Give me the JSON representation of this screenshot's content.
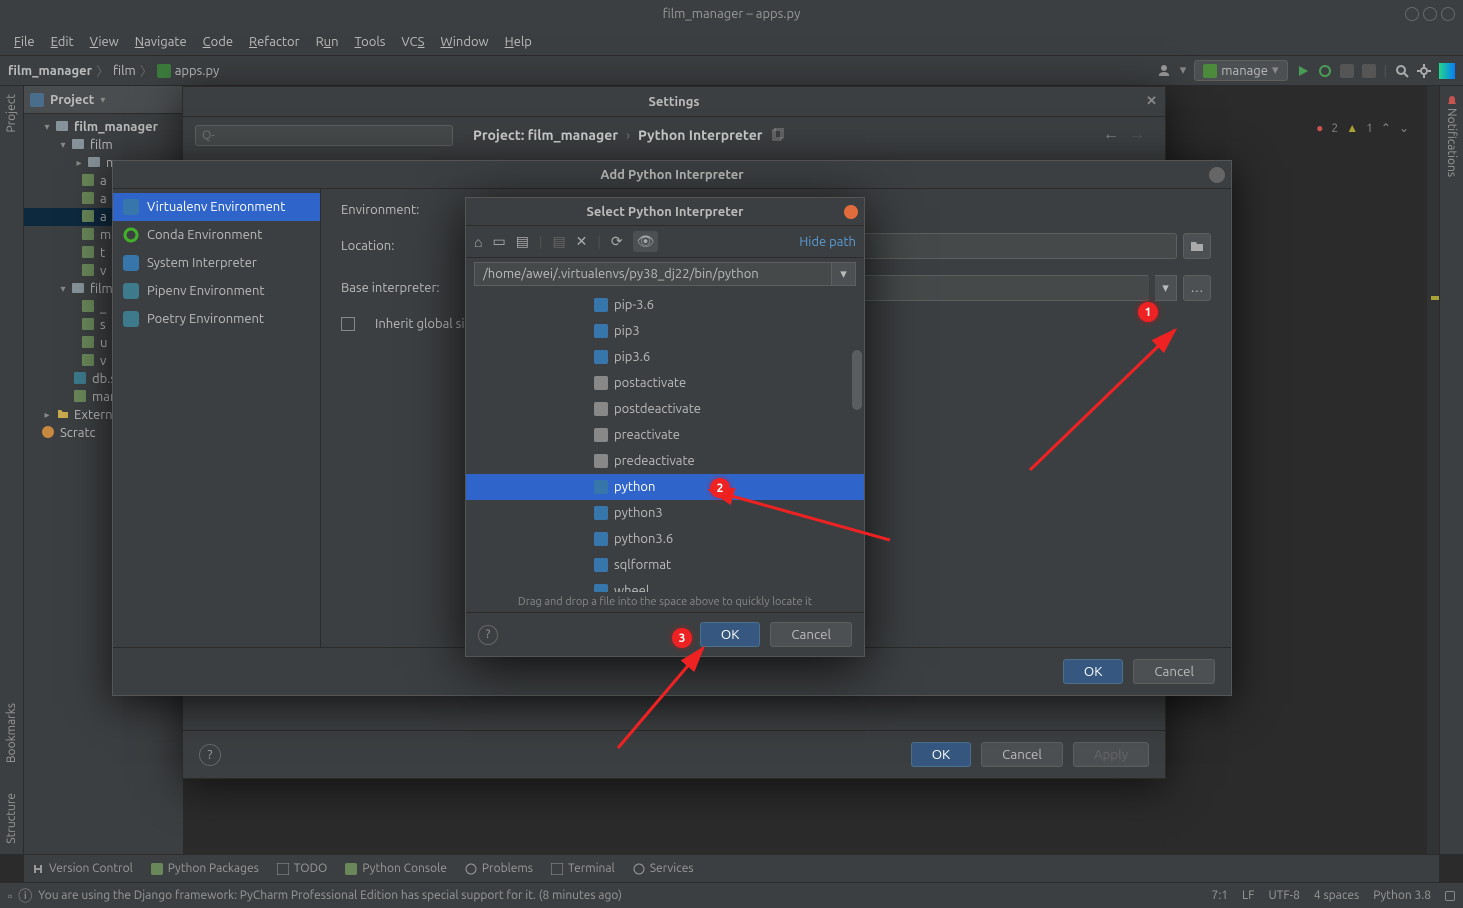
{
  "window": {
    "title": "film_manager – apps.py"
  },
  "menu": [
    "File",
    "Edit",
    "View",
    "Navigate",
    "Code",
    "Refactor",
    "Run",
    "Tools",
    "VCS",
    "Window",
    "Help"
  ],
  "breadcrumb": {
    "root": "film_manager",
    "mid": "film",
    "file": "apps.py"
  },
  "navbar": {
    "manage_btn": "manage"
  },
  "project_panel": {
    "header": "Project",
    "tree": {
      "root": "film_manager",
      "film_dir": "film",
      "m1": "m",
      "a_file": "a",
      "a2": "a",
      "m2": "m",
      "t": "t",
      "v": "v",
      "film2": "film",
      "underscore": "_",
      "s": "s",
      "u": "u",
      "v2": "v",
      "db": "db.s",
      "man": "mar",
      "extern": "Extern",
      "scratch": "Scratc"
    }
  },
  "gutters": {
    "project": "Project",
    "bookmarks": "Bookmarks",
    "structure": "Structure",
    "notifications": "Notifications"
  },
  "inspection": {
    "err": "2",
    "warn": "1"
  },
  "settings": {
    "title": "Settings",
    "search_ph": "Q-",
    "bc_project_label": "Project: film_manager",
    "bc_item": "Python Interpreter",
    "ok": "OK",
    "cancel": "Cancel",
    "apply": "Apply"
  },
  "add_interp": {
    "title": "Add Python Interpreter",
    "left": [
      "Virtualenv Environment",
      "Conda Environment",
      "System Interpreter",
      "Pipenv Environment",
      "Poetry Environment"
    ],
    "env_label": "Environment:",
    "loc_label": "Location:",
    "base_label": "Base interpreter:",
    "inherit": "Inherit global site",
    "ok": "OK",
    "cancel": "Cancel"
  },
  "select": {
    "title": "Select Python Interpreter",
    "hide_path": "Hide path",
    "path": "/home/awei/.virtualenvs/py38_dj22/bin/python",
    "items": [
      "pip-3.6",
      "pip3",
      "pip3.6",
      "postactivate",
      "postdeactivate",
      "preactivate",
      "predeactivate",
      "python",
      "python3",
      "python3.6",
      "sqlformat",
      "wheel"
    ],
    "selected_idx": 7,
    "hint": "Drag and drop a file into the space above to quickly locate it",
    "ok": "OK",
    "cancel": "Cancel"
  },
  "annotations": {
    "a1": "1",
    "a2": "2",
    "a3": "3"
  },
  "bottom_tools": [
    "Version Control",
    "Python Packages",
    "TODO",
    "Python Console",
    "Problems",
    "Terminal",
    "Services"
  ],
  "statusbar": {
    "msg": "You are using the Django framework: PyCharm Professional Edition has special support for it. (8 minutes ago)",
    "pos": "7:1",
    "le": "LF",
    "enc": "UTF-8",
    "indent": "4 spaces",
    "py": "Python 3.8"
  }
}
